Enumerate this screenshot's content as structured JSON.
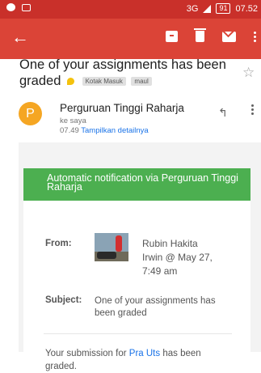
{
  "status_bar": {
    "network": "3G",
    "battery": "91",
    "time": "07.52"
  },
  "toolbar": {
    "back": "←",
    "icons": [
      "archive-icon",
      "trash-icon",
      "mail-icon",
      "more-icon"
    ]
  },
  "email": {
    "subject": "One of your assignments has been graded",
    "labels": [
      "Kotak Masuk",
      "maul"
    ],
    "sender_initial": "P",
    "sender_name": "Perguruan Tinggi Raharja",
    "to": "ke saya",
    "time": "07.49",
    "details_link": "Tampilkan detailnya"
  },
  "body": {
    "banner": "Automatic notification via Perguruan Tinggi Raharja",
    "from_label": "From:",
    "from_value": "Rubin Hakita Irwin @ May 27, 7:49 am",
    "subject_label": "Subject:",
    "subject_value": "One of your assignments has been graded",
    "submission_prefix": "Your submission for",
    "submission_link": "Pra Uts",
    "submission_suffix": "has been graded."
  },
  "colors": {
    "statusbar": "#c9302a",
    "toolbar": "#db4437",
    "banner": "#4caf50",
    "link": "#1a73e8",
    "avatar": "#f5a623"
  }
}
